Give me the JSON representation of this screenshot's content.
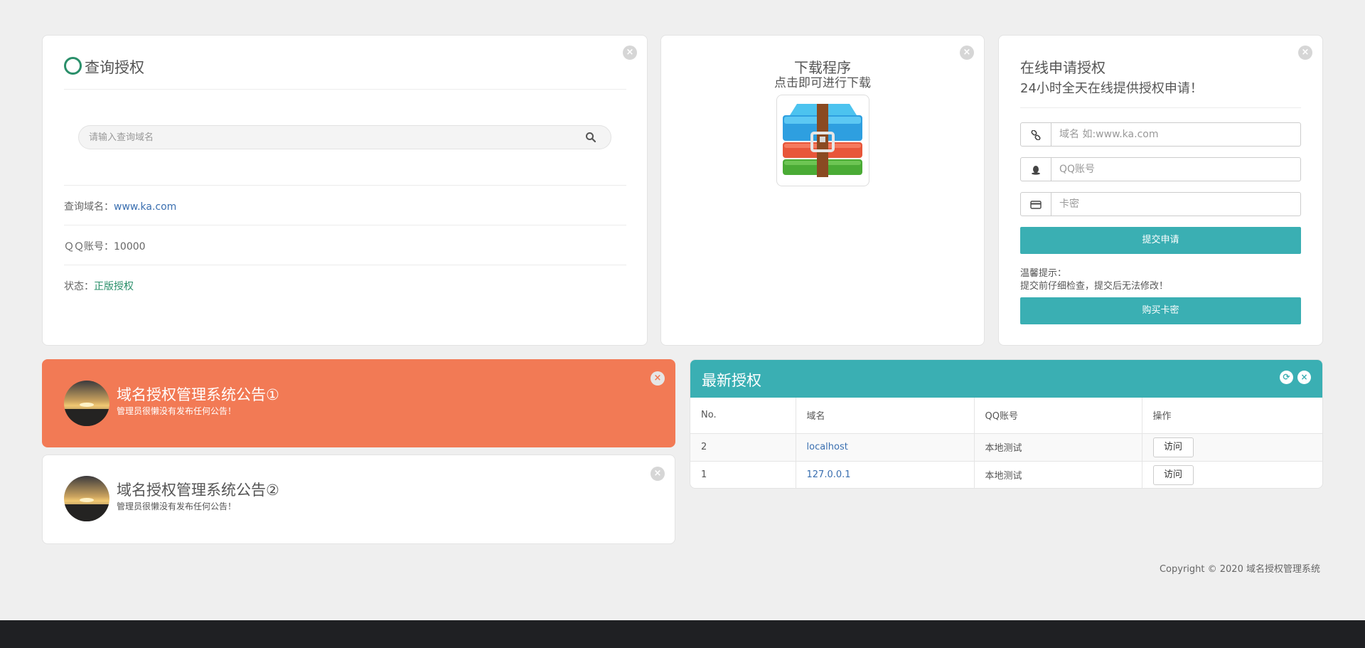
{
  "query": {
    "title": "查询授权",
    "search_placeholder": "请输入查询域名",
    "domain_label": "查询域名：",
    "domain_value": "www.ka.com",
    "qq_label": "ＱＱ账号：",
    "qq_value": "10000",
    "status_label": "状态：",
    "status_value": "正版授权"
  },
  "download": {
    "title": "下载程序",
    "subtitle": "点击即可进行下载",
    "icon": "winrar-archive-icon"
  },
  "apply": {
    "title": "在线申请授权",
    "subtitle": "24小时全天在线提供授权申请！",
    "domain_placeholder": "域名 如:www.ka.com",
    "qq_placeholder": "QQ账号",
    "card_placeholder": "卡密",
    "submit_label": "提交申请",
    "tip_title": "温馨提示：",
    "tip_text": "提交前仔细检查，提交后无法修改！",
    "buy_label": "购买卡密"
  },
  "notices": [
    {
      "title": "域名授权管理系统公告①",
      "text": "管理员很懒没有发布任何公告！"
    },
    {
      "title": "域名授权管理系统公告②",
      "text": "管理员很懒没有发布任何公告！"
    }
  ],
  "latest": {
    "title": "最新授权",
    "columns": [
      "No.",
      "域名",
      "QQ账号",
      "操作"
    ],
    "rows": [
      {
        "no": "2",
        "domain": "localhost",
        "qq": "本地测试",
        "action": "访问"
      },
      {
        "no": "1",
        "domain": "127.0.0.1",
        "qq": "本地测试",
        "action": "访问"
      }
    ]
  },
  "footer": {
    "copyright": "Copyright © 2020 域名授权管理系统"
  },
  "colors": {
    "teal": "#3aafb3",
    "orange": "#f27a55",
    "green": "#2a8f6a",
    "link": "#3a6fb0",
    "footer": "#1f2023"
  }
}
